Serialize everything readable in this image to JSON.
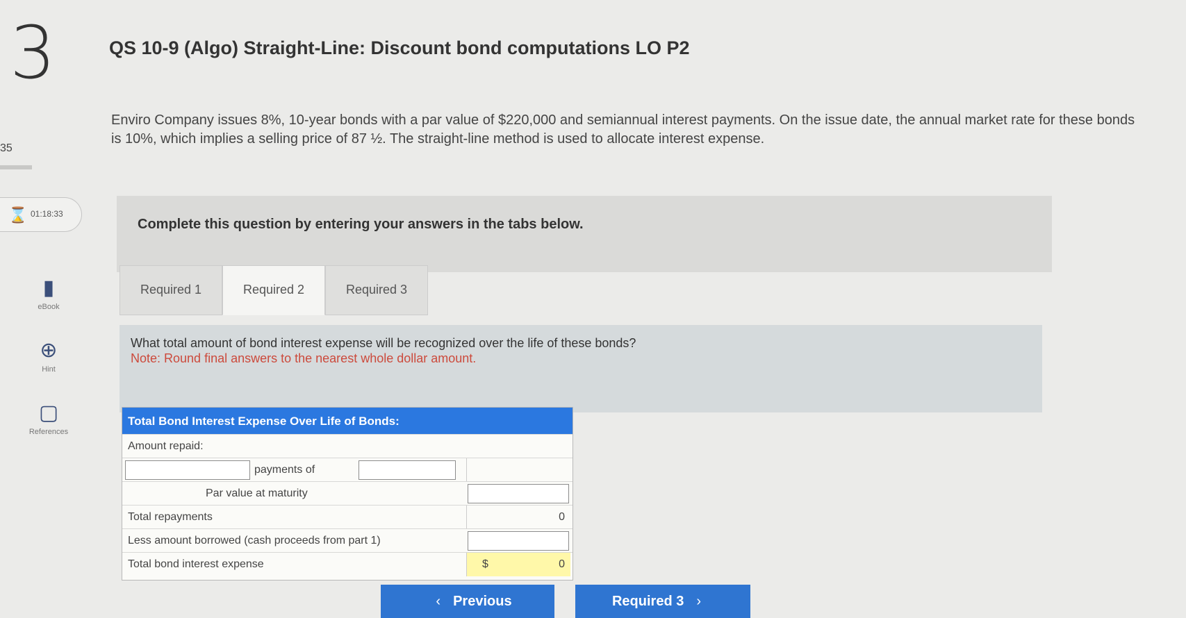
{
  "question": {
    "number": "3",
    "title": "QS 10-9 (Algo) Straight-Line: Discount bond computations LO P2",
    "points": "35",
    "body": "Enviro Company issues 8%, 10-year bonds with a par value of $220,000 and semiannual interest payments. On the issue date, the annual market rate for these bonds is 10%, which implies a selling price of 87 ½. The straight-line method is used to allocate interest expense."
  },
  "timer": {
    "icon": "hourglass-icon",
    "value": "01:18:33"
  },
  "sidebar": {
    "tools": [
      {
        "icon": "ebook-icon",
        "label": "eBook"
      },
      {
        "icon": "hint-icon",
        "label": "Hint"
      },
      {
        "icon": "references-icon",
        "label": "References"
      }
    ]
  },
  "instruction": "Complete this question by entering your answers in the tabs below.",
  "tabs": {
    "items": [
      {
        "label": "Required 1"
      },
      {
        "label": "Required 2",
        "active": true
      },
      {
        "label": "Required 3"
      }
    ]
  },
  "prompt": {
    "question": "What total amount of bond interest expense will be recognized over the life of these bonds?",
    "note": "Note: Round final answers to the nearest whole dollar amount."
  },
  "worksheet": {
    "header": "Total Bond Interest Expense Over Life of Bonds:",
    "rows": {
      "amount_repaid": "Amount repaid:",
      "payments_of": "payments of",
      "par_value": "Par value at maturity",
      "total_repayments": "Total repayments",
      "total_repayments_value": "0",
      "less_amount": "Less amount borrowed (cash proceeds from part 1)",
      "total_interest": "Total bond interest expense",
      "currency": "$",
      "total_interest_value": "0"
    }
  },
  "navigation": {
    "previous": "Previous",
    "next": "Required 3"
  },
  "colors": {
    "accent": "#2f75d1",
    "header": "#2b78e0",
    "note": "#cc4a3c",
    "highlight": "#fff8a9"
  }
}
